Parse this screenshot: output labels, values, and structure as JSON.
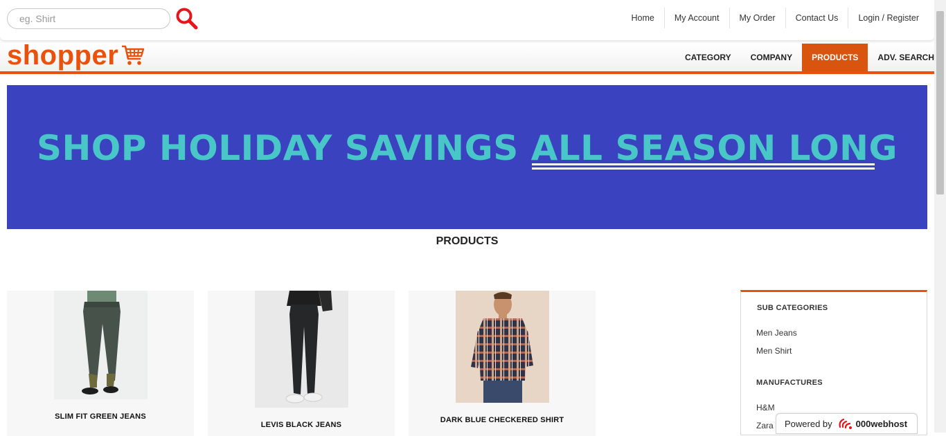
{
  "search": {
    "placeholder": "eg. Shirt"
  },
  "top_links": [
    "Home",
    "My Account",
    "My Order",
    "Contact Us",
    "Login / Register"
  ],
  "logo": {
    "text": "shopper"
  },
  "nav": [
    {
      "label": "CATEGORY",
      "active": false
    },
    {
      "label": "COMPANY",
      "active": false
    },
    {
      "label": "PRODUCTS",
      "active": true
    },
    {
      "label": "ADV. SEARCH",
      "active": false
    }
  ],
  "banner": {
    "text_start": "SHOP HOLIDAY SAVINGS ",
    "text_emphasis": "ALL SEASON LONG"
  },
  "section_title": "PRODUCTS",
  "products": [
    {
      "name": "SLIM FIT GREEN JEANS"
    },
    {
      "name": "LEVIS BLACK JEANS"
    },
    {
      "name": "DARK BLUE CHECKERED SHIRT"
    }
  ],
  "sidebar": {
    "sub_categories_heading": "SUB CATEGORIES",
    "sub_categories": [
      "Men Jeans",
      "Men Shirt"
    ],
    "manufactures_heading": "MANUFACTURES",
    "manufactures": [
      "H&M",
      "Zara"
    ]
  },
  "powered": {
    "prefix": "Powered by",
    "brand": "000webhost"
  },
  "colors": {
    "accent": "#e8520c",
    "banner_bg": "#3a42bf",
    "banner_text": "#48c6c8"
  }
}
